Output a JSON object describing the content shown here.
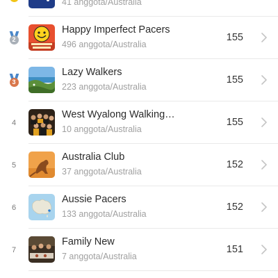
{
  "leaderboard": {
    "rows": [
      {
        "rank": "1",
        "name": "",
        "sub": "41 anggota/Australia",
        "score": "",
        "thumb": "flag-australia-thumbnail",
        "medal_color": "#f2c417"
      },
      {
        "rank": "2",
        "name": "Happy Imperfect Pacers",
        "sub": "496 anggota/Australia",
        "score": "155",
        "thumb": "smiley-thumbnail",
        "medal_color": "#a9b0b8"
      },
      {
        "rank": "3",
        "name": "Lazy Walkers",
        "sub": "223 anggota/Australia",
        "score": "155",
        "thumb": "coast-landscape-thumbnail",
        "medal_color": "#d9774b"
      },
      {
        "rank": "4",
        "name": "West Wyalong Walking…",
        "sub": "10 anggota/Australia",
        "score": "155",
        "thumb": "group-photo-thumbnail"
      },
      {
        "rank": "5",
        "name": "Australia Club",
        "sub": "37 anggota/Australia",
        "score": "152",
        "thumb": "kangaroo-thumbnail"
      },
      {
        "rank": "6",
        "name": "Aussie Pacers",
        "sub": "133 anggota/Australia",
        "score": "152",
        "thumb": "map-thumbnail"
      },
      {
        "rank": "7",
        "name": "Family New",
        "sub": "7 anggota/Australia",
        "score": "151",
        "thumb": "dinner-photo-thumbnail"
      }
    ]
  },
  "icons": {
    "chevron": "chevron-right-icon",
    "medal": "medal-icon"
  },
  "colors": {
    "text_primary": "#2b2b2b",
    "text_secondary": "#a0a0a0",
    "divider": "#e9e9e9",
    "chevron": "#c4c4c4"
  }
}
